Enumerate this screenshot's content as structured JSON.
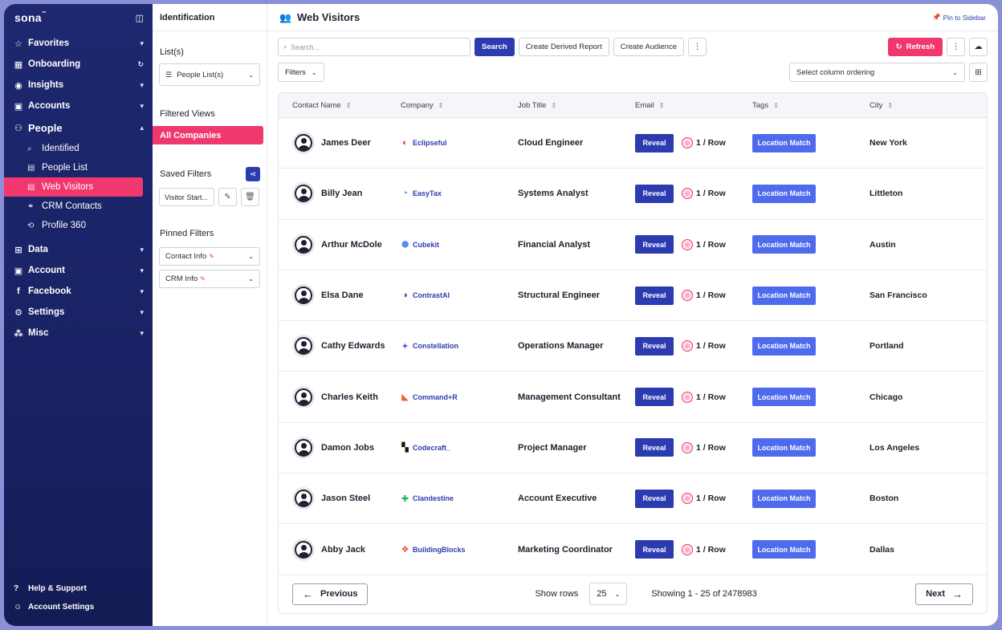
{
  "brand": {
    "name": "sona",
    "tm": "™"
  },
  "sidebar": {
    "items": [
      {
        "label": "Favorites",
        "icon": "star-icon",
        "glyph": "☆",
        "trail": "▾"
      },
      {
        "label": "Onboarding",
        "icon": "grid-icon",
        "glyph": "▦",
        "trail": "↻"
      },
      {
        "label": "Insights",
        "icon": "location-pin-icon",
        "glyph": "◉",
        "trail": "▾"
      },
      {
        "label": "Accounts",
        "icon": "id-card-icon",
        "glyph": "▣",
        "trail": "▾"
      }
    ],
    "people": {
      "label": "People",
      "glyph": "⚇",
      "trail": "▴"
    },
    "people_sub": [
      {
        "label": "Identified",
        "glyph": "⌕",
        "name": "identified"
      },
      {
        "label": "People List",
        "glyph": "▤",
        "name": "people-list"
      },
      {
        "label": "Web Visitors",
        "glyph": "▤",
        "name": "web-visitors"
      },
      {
        "label": "CRM Contacts",
        "glyph": "⚭",
        "name": "crm-contacts"
      },
      {
        "label": "Profile 360",
        "glyph": "⟲",
        "name": "profile-360"
      }
    ],
    "items2": [
      {
        "label": "Data",
        "glyph": "⊞",
        "trail": "▾",
        "name": "data"
      },
      {
        "label": "Account",
        "glyph": "▣",
        "trail": "▾",
        "name": "account"
      },
      {
        "label": "Facebook",
        "glyph": "f",
        "trail": "▾",
        "name": "facebook"
      },
      {
        "label": "Settings",
        "glyph": "⚙",
        "trail": "▾",
        "name": "settings"
      },
      {
        "label": "Misc",
        "glyph": "⁂",
        "trail": "▾",
        "name": "misc"
      }
    ],
    "footer": [
      {
        "label": "Help & Support",
        "glyph": "?",
        "name": "help-support"
      },
      {
        "label": "Account Settings",
        "glyph": "☺",
        "name": "account-settings"
      }
    ]
  },
  "mid": {
    "title": "Identification",
    "lists_label": "List(s)",
    "lists_select": "People List(s)",
    "filtered_views_label": "Filtered Views",
    "all_companies": "All Companies",
    "saved_filters_label": "Saved Filters",
    "saved_chip": "Visitor Start...",
    "pinned_filters_label": "Pinned Filters",
    "pinned": [
      "Contact Info",
      "CRM Info"
    ]
  },
  "main": {
    "title": "Web Visitors",
    "pin_label": "Pin to Sidebar",
    "search_placeholder": "Search...",
    "search_btn": "Search",
    "create_report": "Create Derived Report",
    "create_audience": "Create Audience",
    "refresh": "Refresh",
    "filters": "Filters",
    "column_ordering": "Select column ordering"
  },
  "table": {
    "headers": [
      "Contact Name",
      "Company",
      "Job Title",
      "Email",
      "Tags",
      "City"
    ],
    "reveal_label": "Reveal",
    "rate_label": "1 / Row",
    "tag_label": "Location Match",
    "rows": [
      {
        "name": "James Deer",
        "company": "Eclipseful",
        "company_glyph": "◐",
        "company_color": "#e0245e",
        "title": "Cloud Engineer",
        "city": "New York"
      },
      {
        "name": "Billy Jean",
        "company": "EasyTax",
        "company_glyph": "◔",
        "company_color": "#1e6fd9",
        "title": "Systems Analyst",
        "city": "Littleton"
      },
      {
        "name": "Arthur McDole",
        "company": "Cubekit",
        "company_glyph": "⬢",
        "company_color": "#5b8def",
        "title": "Financial Analyst",
        "city": "Austin"
      },
      {
        "name": "Elsa Dane",
        "company": "ContrastAI",
        "company_glyph": "◑",
        "company_color": "#3a2bb8",
        "title": "Structural Engineer",
        "city": "San Francisco"
      },
      {
        "name": "Cathy Edwards",
        "company": "Constellation",
        "company_glyph": "✦",
        "company_color": "#7b3fe4",
        "title": "Operations Manager",
        "city": "Portland"
      },
      {
        "name": "Charles Keith",
        "company": "Command+R",
        "company_glyph": "◣",
        "company_color": "#f05a28",
        "title": "Management Consultant",
        "city": "Chicago"
      },
      {
        "name": "Damon Jobs",
        "company": "Codecraft_",
        "company_glyph": "▚",
        "company_color": "#111111",
        "title": "Project Manager",
        "city": "Los Angeles"
      },
      {
        "name": "Jason Steel",
        "company": "Clandestine",
        "company_glyph": "✚",
        "company_color": "#19b36b",
        "title": "Account Executive",
        "city": "Boston"
      },
      {
        "name": "Abby Jack",
        "company": "BuildingBlocks",
        "company_glyph": "❖",
        "company_color": "#f05a28",
        "title": "Marketing Coordinator",
        "city": "Dallas"
      }
    ]
  },
  "pager": {
    "previous": "Previous",
    "show_rows": "Show rows",
    "rows_value": "25",
    "showing": "Showing 1 - 25 of 2478983",
    "next": "Next"
  },
  "colors": {
    "brand_pink": "#f0376e",
    "brand_blue": "#2d3bb0",
    "tag_blue": "#4f6bed",
    "sidebar": "#1d2870"
  }
}
